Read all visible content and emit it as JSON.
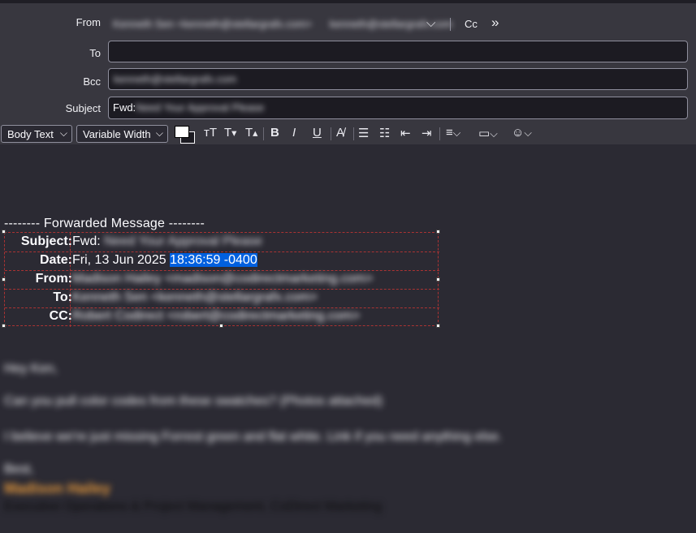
{
  "header": {
    "from_label": "From",
    "from_value": "Kenneth Sen <kenneth@stellargrafx.com>",
    "from_extra": "kenneth@stellargrafx.com",
    "cc_label": "Cc",
    "to_label": "To",
    "to_value": "",
    "bcc_label": "Bcc",
    "bcc_value": "kenneth@stellargrafx.com",
    "subject_label": "Subject",
    "subject_prefix": "Fwd:",
    "subject_rest": "Need Your Approval Please"
  },
  "toolbar": {
    "paragraph_format": "Body Text",
    "font": "Variable Width"
  },
  "message": {
    "forwarded_header": "-------- Forwarded Message --------",
    "rows": [
      {
        "key": "Subject:",
        "prefix": "Fwd:",
        "value": "Need Your Approval Please",
        "blurred": true
      },
      {
        "key": "Date:",
        "prefix": "Fri, 13 Jun 2025",
        "selected": "18:36:59 -0400",
        "blurred": false
      },
      {
        "key": "From:",
        "prefix": "",
        "value": "Madison Hailey <madison@codirectmarketing.com>",
        "blurred": true
      },
      {
        "key": "To:",
        "prefix": "",
        "value": "Kenneth Sen <kenneth@stellargrafx.com>",
        "blurred": true
      },
      {
        "key": "CC:",
        "prefix": "",
        "value": "Robert Codirect <robert@codirectmarketing.com>",
        "blurred": true
      }
    ],
    "greeting": "Hey Ken,",
    "body1": "Can you pull color codes from these swatches? (Photos attached)",
    "body2": "I believe we're just missing Forrest green and flat white. Link if you need anything else.",
    "signoff": "Best,",
    "sig_name": "Madison Hailey",
    "sig_title": "Executive Operations & Project Management, CoDirect Marketing"
  }
}
